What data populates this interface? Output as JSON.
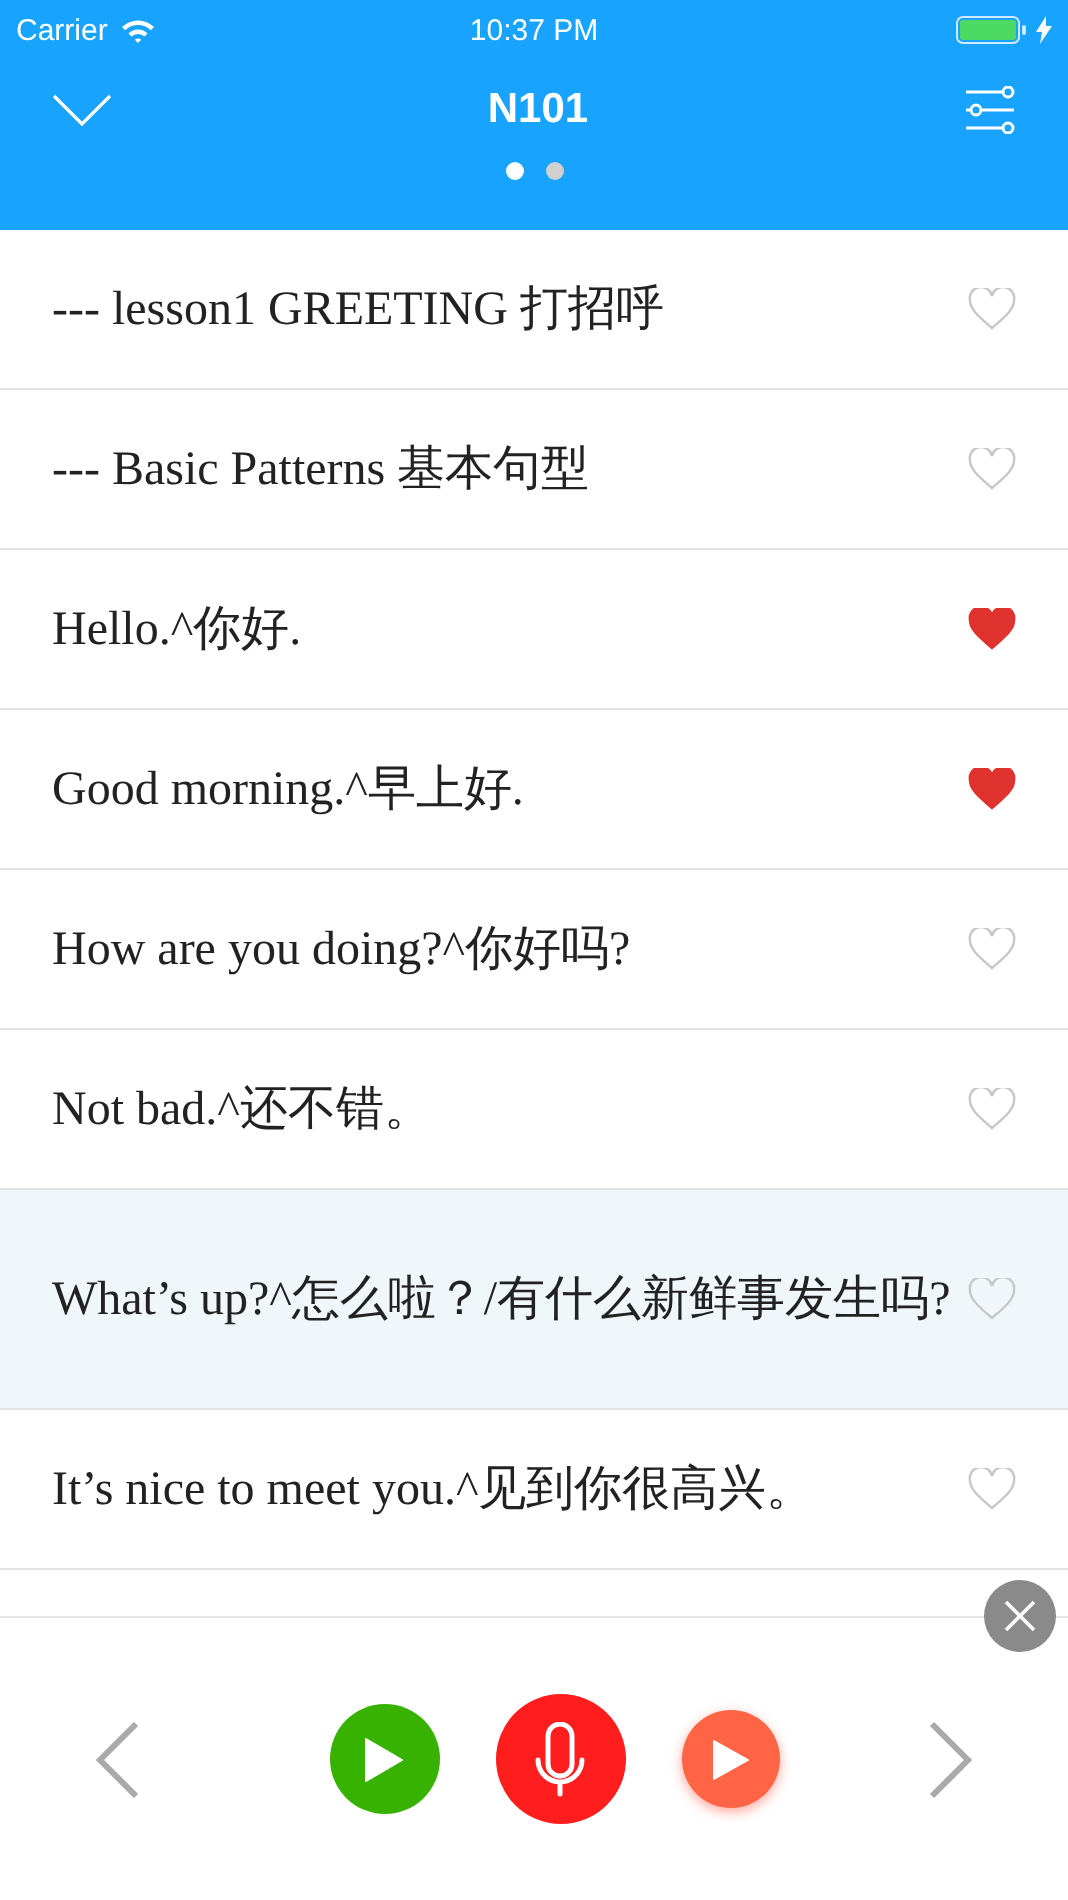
{
  "status_bar": {
    "carrier": "Carrier",
    "time": "10:37 PM"
  },
  "header": {
    "title": "N101",
    "pages": [
      {
        "selected": true
      },
      {
        "selected": false
      }
    ]
  },
  "phrases": [
    {
      "text": "--- lesson1 GREETING 打招呼",
      "favorite": false,
      "selected": false
    },
    {
      "text": "--- Basic Patterns 基本句型",
      "favorite": false,
      "selected": false
    },
    {
      "text": "Hello.^你好.",
      "favorite": true,
      "selected": false
    },
    {
      "text": "Good morning.^早上好.",
      "favorite": true,
      "selected": false
    },
    {
      "text": "How are you doing?^你好吗?",
      "favorite": false,
      "selected": false
    },
    {
      "text": "Not bad.^还不错。",
      "favorite": false,
      "selected": false
    },
    {
      "text": "What’s up?^怎么啦？/有什么新鲜事发生吗?",
      "favorite": false,
      "selected": true
    },
    {
      "text": "It’s nice to meet you.^见到你很高兴。",
      "favorite": false,
      "selected": false
    }
  ]
}
